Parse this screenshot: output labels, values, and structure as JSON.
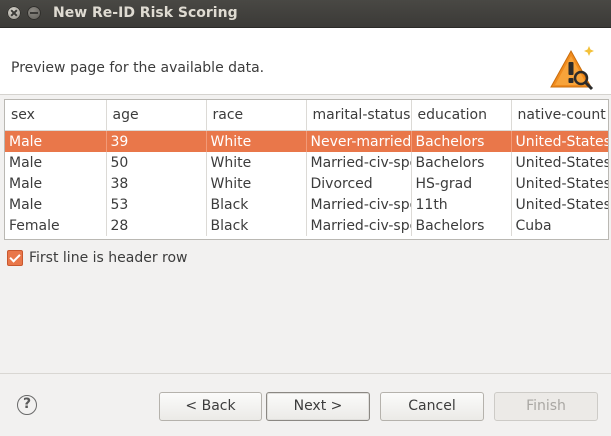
{
  "window": {
    "title": "New Re-ID Risk Scoring"
  },
  "header": {
    "description": "Preview page for the available data.",
    "icon": "warning-magnifier-icon"
  },
  "table": {
    "columns": [
      "sex",
      "age",
      "race",
      "marital-status",
      "education",
      "native-count"
    ],
    "rows": [
      [
        "Male",
        "39",
        "White",
        "Never-married",
        "Bachelors",
        "United-States"
      ],
      [
        "Male",
        "50",
        "White",
        "Married-civ-spo",
        "Bachelors",
        "United-States"
      ],
      [
        "Male",
        "38",
        "White",
        "Divorced",
        "HS-grad",
        "United-States"
      ],
      [
        "Male",
        "53",
        "Black",
        "Married-civ-spo",
        "11th",
        "United-States"
      ],
      [
        "Female",
        "28",
        "Black",
        "Married-civ-spo",
        "Bachelors",
        "Cuba"
      ]
    ],
    "selected_row": 0
  },
  "options": {
    "header_row_label": "First line is header row",
    "header_row_checked": true
  },
  "footer": {
    "help_label": "?",
    "back_label": "< Back",
    "next_label": "Next >",
    "cancel_label": "Cancel",
    "finish_label": "Finish"
  },
  "colors": {
    "accent": "#e9774a",
    "titlebar": "#3c3b37"
  }
}
